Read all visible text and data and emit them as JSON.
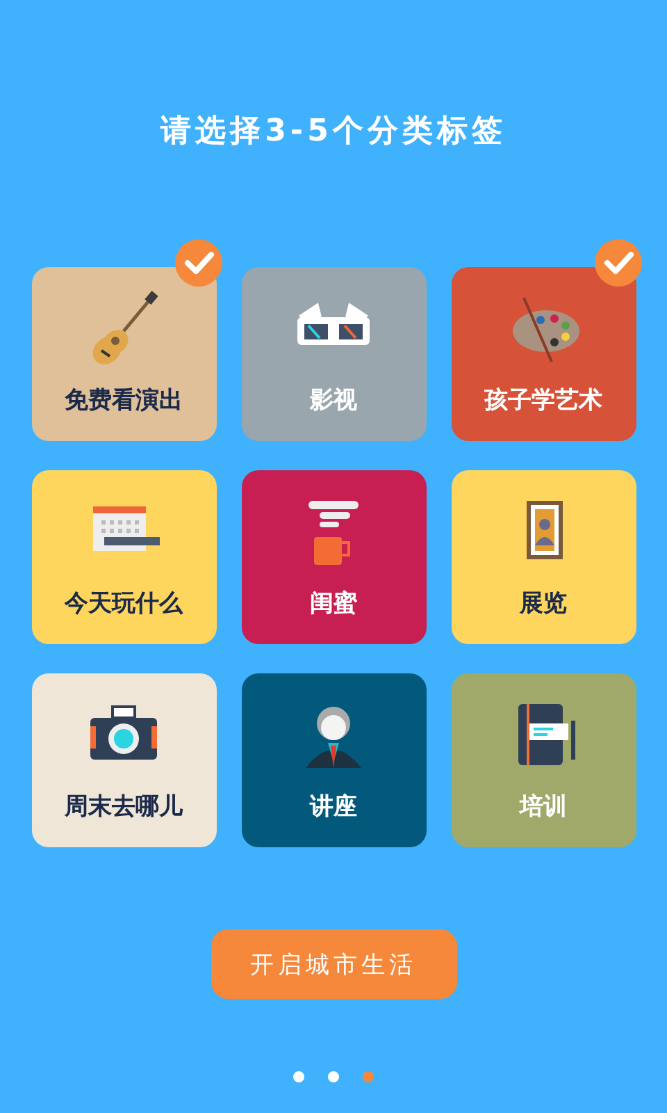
{
  "title": "请选择3-5个分类标签",
  "tiles": [
    {
      "label": "免费看演出",
      "color": "#dfc099",
      "selected": true
    },
    {
      "label": "影视",
      "color": "#9aa6ae",
      "selected": false
    },
    {
      "label": "孩子学艺术",
      "color": "#d65238",
      "selected": true
    },
    {
      "label": "今天玩什么",
      "color": "#fed55d",
      "selected": false
    },
    {
      "label": "闺蜜",
      "color": "#c71f52",
      "selected": false
    },
    {
      "label": "展览",
      "color": "#fed55d",
      "selected": false
    },
    {
      "label": "周末去哪儿",
      "color": "#efe6d8",
      "selected": false
    },
    {
      "label": "讲座",
      "color": "#02597b",
      "selected": false
    },
    {
      "label": "培训",
      "color": "#a0a96a",
      "selected": false
    }
  ],
  "start_button": "开启城市生活",
  "pages": [
    {
      "selected": false
    },
    {
      "selected": false
    },
    {
      "selected": true
    }
  ]
}
